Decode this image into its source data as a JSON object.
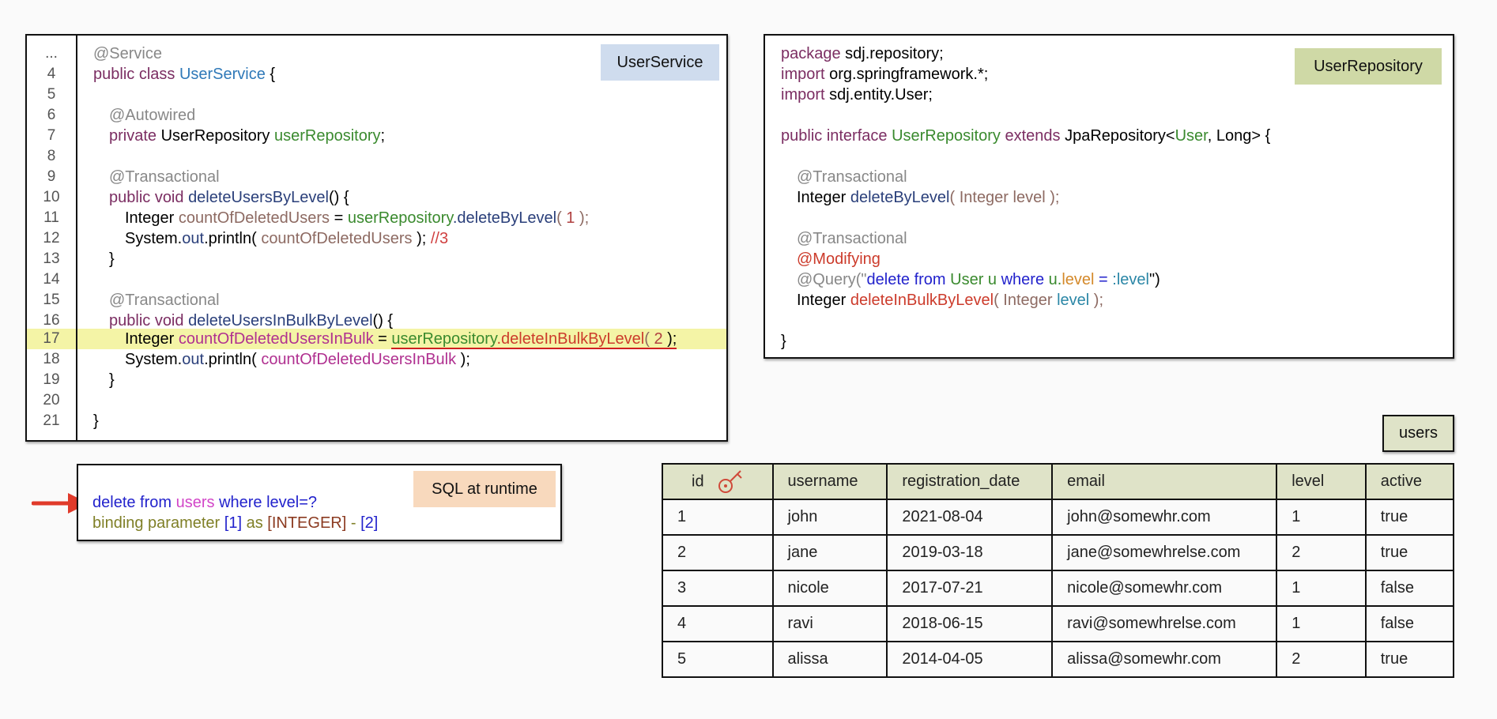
{
  "user_service": {
    "tag": "UserService",
    "line_numbers": [
      "...",
      "4",
      "5",
      "6",
      "7",
      "8",
      "9",
      "10",
      "11",
      "12",
      "13",
      "14",
      "15",
      "16",
      "17",
      "18",
      "19",
      "20",
      "21"
    ],
    "l_service": "@Service",
    "l4_public": "public class ",
    "l4_class": "UserService",
    "l4_brace": " {",
    "l6": "@Autowired",
    "l7_private": "private ",
    "l7_type": "UserRepository ",
    "l7_field": "userRepository",
    "l7_semi": ";",
    "l9": "@Transactional",
    "l10_kw": "public void ",
    "l10_method": "deleteUsersByLevel",
    "l10_rest": "() {",
    "l11_type": "Integer ",
    "l11_var": "countOfDeletedUsers",
    "l11_eq": " = ",
    "l11_field": "userRepository",
    "l11_method": ".deleteByLevel",
    "l11_open": "( ",
    "l11_num": "1",
    "l11_close": " );",
    "l12_sys": "System.",
    "l12_out": "out",
    "l12_println": ".println( ",
    "l12_var": "countOfDeletedUsers",
    "l12_close": " ); ",
    "l12_comment": "//3",
    "l13": "}",
    "l15": "@Transactional",
    "l16_kw": "public void ",
    "l16_method": "deleteUsersInBulkByLevel",
    "l16_rest": "() {",
    "l17_type": "Integer ",
    "l17_var": "countOfDeletedUsersInBulk",
    "l17_eq": " = ",
    "l17_field": "userRepository",
    "l17_method": ".deleteInBulkByLevel",
    "l17_open": "( ",
    "l17_num": "2",
    "l17_close": " );",
    "l18_sys": "System.",
    "l18_out": "out",
    "l18_println": ".println( ",
    "l18_var": "countOfDeletedUsersInBulk",
    "l18_close": " );",
    "l19": "}",
    "l21": "}"
  },
  "user_repository": {
    "tag": "UserRepository",
    "l1_kw": "package ",
    "l1_rest": "sdj.repository;",
    "l2_kw": "import ",
    "l2_rest": "org.springframework.*;",
    "l3_kw": "import ",
    "l3_rest": "sdj.entity.User;",
    "l5_kw": "public interface ",
    "l5_name": "UserRepository",
    "l5_ext": " extends ",
    "l5_jpa": "JpaRepository<",
    "l5_user": "User",
    "l5_rest": ", Long> {",
    "l7": "@Transactional",
    "l8_type": "Integer ",
    "l8_method": "deleteByLevel",
    "l8_open": "( Integer ",
    "l8_param": "level",
    "l8_close": " );",
    "l10": "@Transactional",
    "l11": "@Modifying",
    "l12_q": "@Query(\"",
    "l12_delete": "delete from ",
    "l12_user": "User u ",
    "l12_where": "where ",
    "l12_u": "u.",
    "l12_level": "level",
    "l12_eq": " = ",
    "l12_param": ":level",
    "l12_end": "\")",
    "l13_type": "Integer ",
    "l13_method": "deleteInBulkByLevel",
    "l13_open": "( Integer ",
    "l13_param": "level",
    "l13_close": " );",
    "l15": "}"
  },
  "sql_runtime": {
    "tag": "SQL at runtime",
    "l1_delete": "delete from ",
    "l1_users": "users",
    "l1_where": " where level=?",
    "l2_binding": "binding parameter ",
    "l2_idx": "[1]",
    "l2_as": " as ",
    "l2_type": "[INTEGER]",
    "l2_dash": " - ",
    "l2_val": "[2]"
  },
  "users_table": {
    "tag": "users",
    "columns": [
      "id",
      "username",
      "registration_date",
      "email",
      "level",
      "active"
    ],
    "rows": [
      [
        "1",
        "john",
        "2021-08-04",
        "john@somewhr.com",
        "1",
        "true"
      ],
      [
        "2",
        "jane",
        "2019-03-18",
        "jane@somewhrelse.com",
        "2",
        "true"
      ],
      [
        "3",
        "nicole",
        "2017-07-21",
        "nicole@somewhr.com",
        "1",
        "false"
      ],
      [
        "4",
        "ravi",
        "2018-06-15",
        "ravi@somewhrelse.com",
        "1",
        "false"
      ],
      [
        "5",
        "alissa",
        "2014-04-05",
        "alissa@somewhr.com",
        "2",
        "true"
      ]
    ]
  },
  "colors": {
    "highlight": "#f4f4a6",
    "service_tag": "#cfdcee",
    "repo_tag": "#cfd9a6",
    "sql_tag": "#f8d9bd",
    "table_header": "#dfe3c8",
    "arrow": "#e03a2a"
  }
}
